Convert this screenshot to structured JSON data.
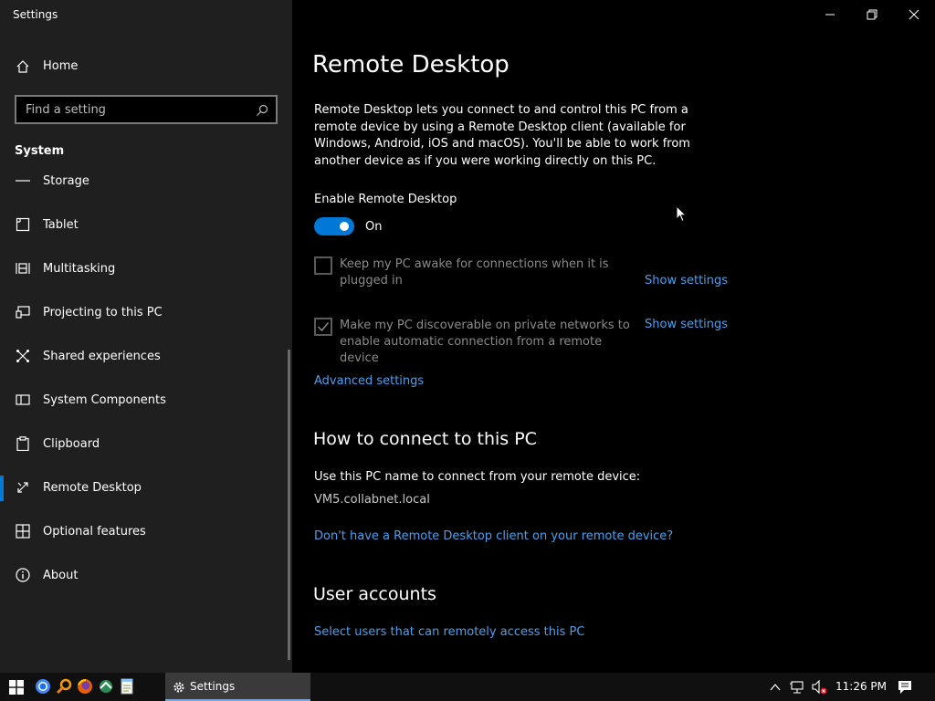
{
  "window": {
    "title": "Settings",
    "controls": [
      "minimize",
      "restore",
      "close"
    ]
  },
  "sidebar": {
    "home_label": "Home",
    "search_placeholder": "Find a setting",
    "section_label": "System",
    "items": [
      {
        "label": "Storage",
        "icon": "storage-icon"
      },
      {
        "label": "Tablet",
        "icon": "tablet-icon"
      },
      {
        "label": "Multitasking",
        "icon": "multitasking-icon"
      },
      {
        "label": "Projecting to this PC",
        "icon": "projecting-icon"
      },
      {
        "label": "Shared experiences",
        "icon": "shared-experiences-icon"
      },
      {
        "label": "System Components",
        "icon": "system-components-icon"
      },
      {
        "label": "Clipboard",
        "icon": "clipboard-icon"
      },
      {
        "label": "Remote Desktop",
        "icon": "remote-desktop-icon",
        "active": true
      },
      {
        "label": "Optional features",
        "icon": "optional-features-icon"
      },
      {
        "label": "About",
        "icon": "info-icon"
      }
    ]
  },
  "main": {
    "title": "Remote Desktop",
    "description": "Remote Desktop lets you connect to and control this PC from a remote device by using a Remote Desktop client (available for Windows, Android, iOS and macOS). You'll be able to work from another device as if you were working directly on this PC.",
    "enable_label": "Enable Remote Desktop",
    "toggle_state": "On",
    "toggle_on": true,
    "options": [
      {
        "label": "Keep my PC awake for connections when it is plugged in",
        "checked": false,
        "link": "Show settings"
      },
      {
        "label": "Make my PC discoverable on private networks to enable automatic connection from a remote device",
        "checked": true,
        "link": "Show settings"
      }
    ],
    "advanced_link": "Advanced settings",
    "connect_heading": "How to connect to this PC",
    "connect_text": "Use this PC name to connect from your remote device:",
    "pc_name": "VM5.collabnet.local",
    "client_link": "Don't have a Remote Desktop client on your remote device?",
    "accounts_heading": "User accounts",
    "accounts_link": "Select users that can remotely access this PC"
  },
  "taskbar": {
    "active_app_label": "Settings",
    "clock": "11:26 PM",
    "accent": "#0078d7"
  }
}
